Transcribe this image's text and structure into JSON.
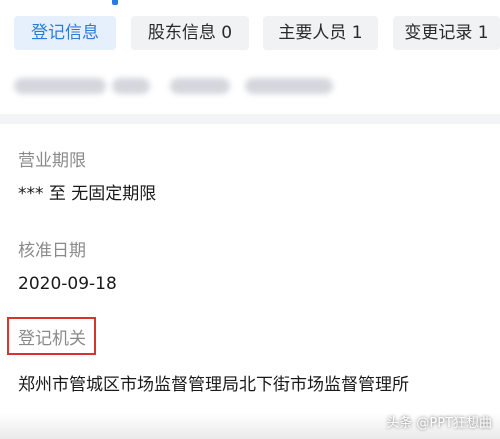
{
  "tabs": [
    {
      "label": "登记信息",
      "active": true
    },
    {
      "label": "股东信息 0",
      "active": false
    },
    {
      "label": "主要人员 1",
      "active": false
    },
    {
      "label": "变更记录 1",
      "active": false
    }
  ],
  "fields": {
    "business_term": {
      "label": "营业期限",
      "value": "*** 至 无固定期限"
    },
    "approval_date": {
      "label": "核准日期",
      "value": "2020-09-18"
    },
    "registration_authority": {
      "label": "登记机关",
      "value": "郑州市管城区市场监督管理局北下街市场监督管理所"
    }
  },
  "watermark": "头条 @PPT狂想曲",
  "colors": {
    "accent": "#2b7cd9",
    "highlight": "#d9342b"
  }
}
